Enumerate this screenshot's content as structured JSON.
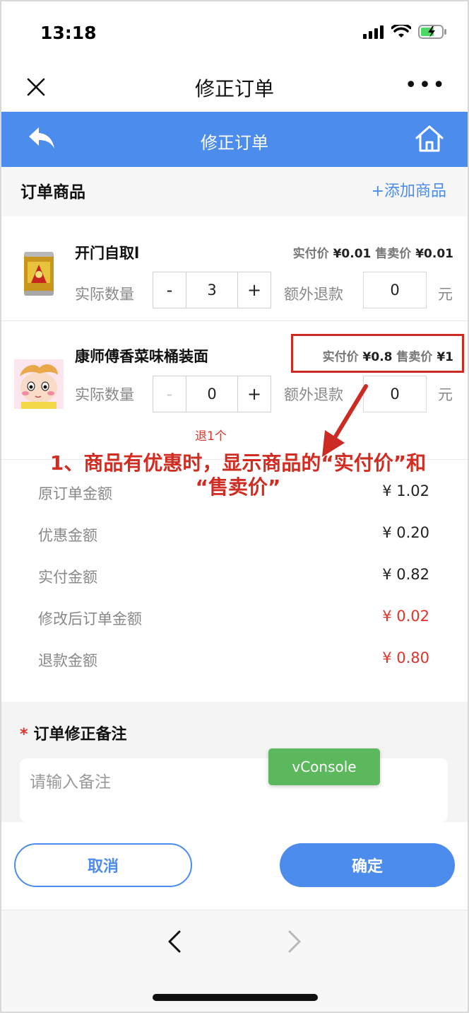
{
  "status_bar": {
    "time": "13:18"
  },
  "wx_nav": {
    "title": "修正订单",
    "more": "•••"
  },
  "header": {
    "title": "修正订单"
  },
  "section": {
    "title": "订单商品",
    "add_label": "+添加商品"
  },
  "products": [
    {
      "name": "开门自取l",
      "paid_label": "实付价",
      "paid_value": "¥0.01",
      "sale_label": "售卖价",
      "sale_value": "¥0.01",
      "qty_label": "实际数量",
      "minus": "-",
      "qty": "3",
      "plus": "+",
      "refund_label": "额外退款",
      "refund": "0",
      "unit": "元"
    },
    {
      "name": "康师傅香菜味桶装面",
      "paid_label": "实付价",
      "paid_value": "¥0.8",
      "sale_label": "售卖价",
      "sale_value": "¥1",
      "qty_label": "实际数量",
      "minus": "-",
      "qty": "0",
      "plus": "+",
      "refund_label": "额外退款",
      "refund": "0",
      "unit": "元",
      "note": "退1个"
    }
  ],
  "annotation": {
    "line1": "1、商品有优惠时，显示商品的“实付价”和",
    "line2": "“售卖价”"
  },
  "summary": [
    {
      "label": "原订单金额",
      "value": "¥ 1.02"
    },
    {
      "label": "优惠金额",
      "value": "¥ 0.20"
    },
    {
      "label": "实付金额",
      "value": "¥ 0.82"
    },
    {
      "label": "修改后订单金额",
      "value": "¥ 0.02"
    },
    {
      "label": "退款金额",
      "value": "¥ 0.80"
    }
  ],
  "remark": {
    "star": "*",
    "title": "订单修正备注",
    "placeholder": "请输入备注"
  },
  "vconsole": "vConsole",
  "actions": {
    "cancel": "取消",
    "confirm": "确定"
  },
  "colors": {
    "accent": "#4b8ced",
    "danger": "#e0332b",
    "annotation": "#d12c22",
    "vconsole": "#5cb85c"
  }
}
